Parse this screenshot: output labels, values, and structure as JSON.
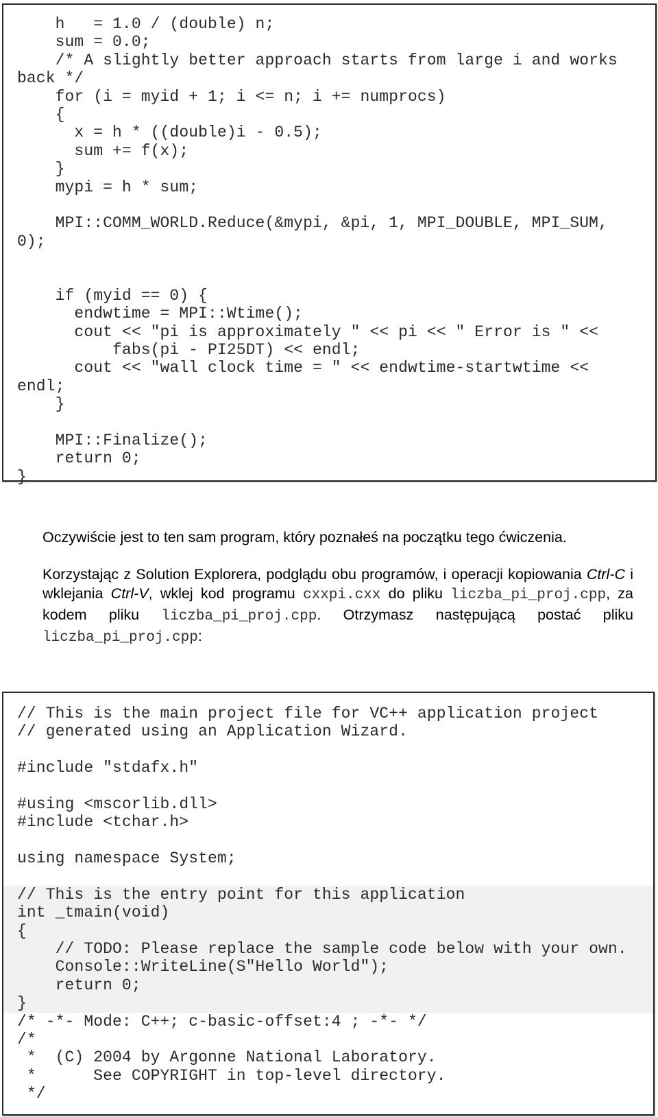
{
  "code_block_1": {
    "lines": [
      "    h   = 1.0 / (double) n;",
      "    sum = 0.0;",
      "    /* A slightly better approach starts from large i and works",
      "back */",
      "    for (i = myid + 1; i <= n; i += numprocs)",
      "    {",
      "      x = h * ((double)i - 0.5);",
      "      sum += f(x);",
      "    }",
      "    mypi = h * sum;",
      "",
      "    MPI::COMM_WORLD.Reduce(&mypi, &pi, 1, MPI_DOUBLE, MPI_SUM,",
      "0);",
      "",
      "",
      "    if (myid == 0) {",
      "      endwtime = MPI::Wtime();",
      "      cout << \"pi is approximately \" << pi << \" Error is \" <<",
      "          fabs(pi - PI25DT) << endl;",
      "      cout << \"wall clock time = \" << endwtime-startwtime <<",
      "endl;",
      "    }",
      "",
      "    MPI::Finalize();",
      "    return 0;",
      "}"
    ]
  },
  "paragraph_1": "Oczywiście jest to ten sam program, który poznałeś na początku tego ćwiczenia.",
  "paragraph_2": {
    "t1": "Korzystając z Solution Explorera, podglądu obu programów, i operacji kopiowania ",
    "ctrl_c": "Ctrl-C",
    "t2": " i wklejania ",
    "ctrl_v": "Ctrl-V",
    "t3": ", wklej kod programu ",
    "file_src": "cxxpi.cxx",
    "t4": " do pliku ",
    "file_dst": "liczba_pi_proj.cpp",
    "t5": ", za kodem pliku ",
    "file_dst2": "liczba_pi_proj.cpp",
    "t6": ". Otrzymasz następującą postać pliku ",
    "file_dst3": "liczba_pi_proj.cpp",
    "t7": ":"
  },
  "code_block_2": {
    "highlight_color": "#f1f1f1",
    "lines": [
      "// This is the main project file for VC++ application project",
      "// generated using an Application Wizard.",
      "",
      "#include \"stdafx.h\"",
      "",
      "#using <mscorlib.dll>",
      "#include <tchar.h>",
      "",
      "using namespace System;",
      "",
      "// This is the entry point for this application",
      "int _tmain(void)",
      "{",
      "    // TODO: Please replace the sample code below with your own.",
      "    Console::WriteLine(S\"Hello World\");",
      "    return 0;",
      "}",
      "/* -*- Mode: C++; c-basic-offset:4 ; -*- */",
      "/*",
      " *  (C) 2004 by Argonne National Laboratory.",
      " *      See COPYRIGHT in top-level directory.",
      " */"
    ]
  }
}
